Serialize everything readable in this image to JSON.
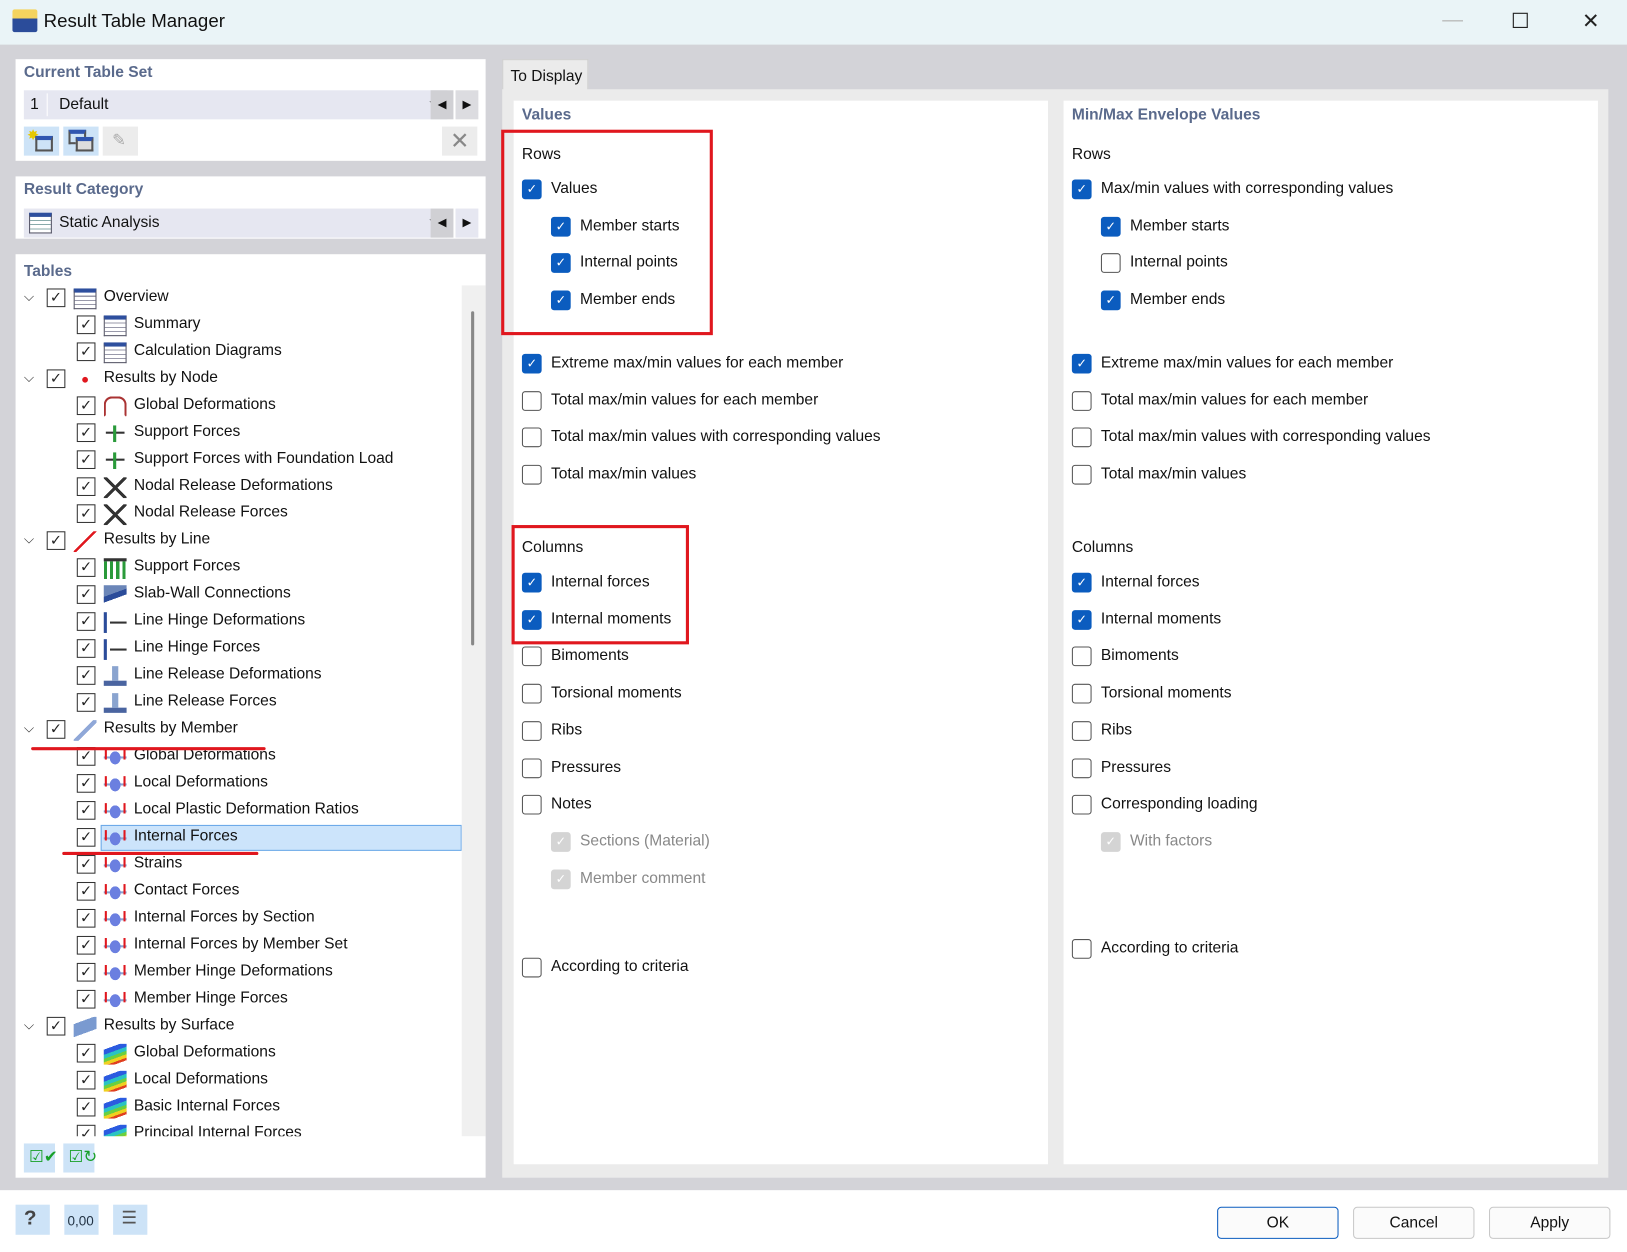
{
  "window": {
    "title": "Result Table Manager",
    "minimize": "—",
    "maximize": "☐",
    "close": "✕"
  },
  "current_table_set": {
    "heading": "Current Table Set",
    "number": "1",
    "value": "Default"
  },
  "result_category": {
    "heading": "Result Category",
    "value": "Static Analysis"
  },
  "tables": {
    "heading": "Tables",
    "items": [
      {
        "level": 1,
        "label": "Overview",
        "icon": "table-icon"
      },
      {
        "level": 2,
        "label": "Summary",
        "icon": "table-icon"
      },
      {
        "level": 2,
        "label": "Calculation Diagrams",
        "icon": "table-icon"
      },
      {
        "level": 1,
        "label": "Results by Node",
        "icon": "node-icon"
      },
      {
        "level": 2,
        "label": "Global Deformations",
        "icon": "deformation-icon"
      },
      {
        "level": 2,
        "label": "Support Forces",
        "icon": "support-icon"
      },
      {
        "level": 2,
        "label": "Support Forces with Foundation Load",
        "icon": "support-icon"
      },
      {
        "level": 2,
        "label": "Nodal Release Deformations",
        "icon": "release-icon"
      },
      {
        "level": 2,
        "label": "Nodal Release Forces",
        "icon": "release-icon"
      },
      {
        "level": 1,
        "label": "Results by Line",
        "icon": "line-icon"
      },
      {
        "level": 2,
        "label": "Support Forces",
        "icon": "line-support-icon"
      },
      {
        "level": 2,
        "label": "Slab-Wall Connections",
        "icon": "slab-wall-icon"
      },
      {
        "level": 2,
        "label": "Line Hinge Deformations",
        "icon": "hinge-icon"
      },
      {
        "level": 2,
        "label": "Line Hinge Forces",
        "icon": "hinge-icon"
      },
      {
        "level": 2,
        "label": "Line Release Deformations",
        "icon": "line-release-icon"
      },
      {
        "level": 2,
        "label": "Line Release Forces",
        "icon": "line-release-icon"
      },
      {
        "level": 1,
        "label": "Results by Member",
        "icon": "member-icon"
      },
      {
        "level": 2,
        "label": "Global Deformations",
        "icon": "member-diagram-icon"
      },
      {
        "level": 2,
        "label": "Local Deformations",
        "icon": "member-diagram-icon"
      },
      {
        "level": 2,
        "label": "Local Plastic Deformation Ratios",
        "icon": "member-diagram-icon"
      },
      {
        "level": 2,
        "label": "Internal Forces",
        "icon": "member-diagram-icon",
        "selected": true
      },
      {
        "level": 2,
        "label": "Strains",
        "icon": "member-diagram-icon"
      },
      {
        "level": 2,
        "label": "Contact Forces",
        "icon": "member-diagram-icon"
      },
      {
        "level": 2,
        "label": "Internal Forces by Section",
        "icon": "member-diagram-icon"
      },
      {
        "level": 2,
        "label": "Internal Forces by Member Set",
        "icon": "member-diagram-icon"
      },
      {
        "level": 2,
        "label": "Member Hinge Deformations",
        "icon": "member-diagram-icon"
      },
      {
        "level": 2,
        "label": "Member Hinge Forces",
        "icon": "member-diagram-icon"
      },
      {
        "level": 1,
        "label": "Results by Surface",
        "icon": "surface-icon"
      },
      {
        "level": 2,
        "label": "Global Deformations",
        "icon": "surface-contour-icon"
      },
      {
        "level": 2,
        "label": "Local Deformations",
        "icon": "surface-contour-icon"
      },
      {
        "level": 2,
        "label": "Basic Internal Forces",
        "icon": "surface-contour-icon"
      },
      {
        "level": 2,
        "label": "Principal Internal Forces",
        "icon": "surface-contour-icon"
      }
    ]
  },
  "tab": {
    "label": "To Display"
  },
  "values": {
    "heading": "Values",
    "rows_label": "Rows",
    "columns_label": "Columns",
    "rows": [
      {
        "label": "Values",
        "checked": true,
        "indent": 0
      },
      {
        "label": "Member starts",
        "checked": true,
        "indent": 1
      },
      {
        "label": "Internal points",
        "checked": true,
        "indent": 1
      },
      {
        "label": "Member ends",
        "checked": true,
        "indent": 1
      }
    ],
    "extremes": [
      {
        "label": "Extreme max/min values for each member",
        "checked": true
      },
      {
        "label": "Total max/min values for each member",
        "checked": false
      },
      {
        "label": "Total max/min values with corresponding values",
        "checked": false
      },
      {
        "label": "Total max/min values",
        "checked": false
      }
    ],
    "columns": [
      {
        "label": "Internal forces",
        "checked": true,
        "indent": 0
      },
      {
        "label": "Internal moments",
        "checked": true,
        "indent": 0
      },
      {
        "label": "Bimoments",
        "checked": false,
        "indent": 0
      },
      {
        "label": "Torsional moments",
        "checked": false,
        "indent": 0
      },
      {
        "label": "Ribs",
        "checked": false,
        "indent": 0
      },
      {
        "label": "Pressures",
        "checked": false,
        "indent": 0
      },
      {
        "label": "Notes",
        "checked": false,
        "indent": 0
      },
      {
        "label": "Sections (Material)",
        "checked": true,
        "indent": 1,
        "disabled": true
      },
      {
        "label": "Member comment",
        "checked": true,
        "indent": 1,
        "disabled": true
      }
    ],
    "criteria": {
      "label": "According to criteria",
      "checked": false
    }
  },
  "envelope": {
    "heading": "Min/Max Envelope Values",
    "rows_label": "Rows",
    "columns_label": "Columns",
    "rows": [
      {
        "label": "Max/min values with corresponding values",
        "checked": true,
        "indent": 0
      },
      {
        "label": "Member starts",
        "checked": true,
        "indent": 1
      },
      {
        "label": "Internal points",
        "checked": false,
        "indent": 1
      },
      {
        "label": "Member ends",
        "checked": true,
        "indent": 1
      }
    ],
    "extremes": [
      {
        "label": "Extreme max/min values for each member",
        "checked": true
      },
      {
        "label": "Total max/min values for each member",
        "checked": false
      },
      {
        "label": "Total max/min values with corresponding values",
        "checked": false
      },
      {
        "label": "Total max/min values",
        "checked": false
      }
    ],
    "columns": [
      {
        "label": "Internal forces",
        "checked": true,
        "indent": 0
      },
      {
        "label": "Internal moments",
        "checked": true,
        "indent": 0
      },
      {
        "label": "Bimoments",
        "checked": false,
        "indent": 0
      },
      {
        "label": "Torsional moments",
        "checked": false,
        "indent": 0
      },
      {
        "label": "Ribs",
        "checked": false,
        "indent": 0
      },
      {
        "label": "Pressures",
        "checked": false,
        "indent": 0
      },
      {
        "label": "Corresponding loading",
        "checked": false,
        "indent": 0
      },
      {
        "label": "With factors",
        "checked": true,
        "indent": 1,
        "disabled": true
      }
    ],
    "criteria": {
      "label": "According to criteria",
      "checked": false
    }
  },
  "buttons": {
    "ok": "OK",
    "cancel": "Cancel",
    "apply": "Apply"
  },
  "units_icon_text": "0,00",
  "colors": {
    "accent": "#0b5cbf",
    "annotation": "#e0171e",
    "selection": "#cce4fb"
  }
}
